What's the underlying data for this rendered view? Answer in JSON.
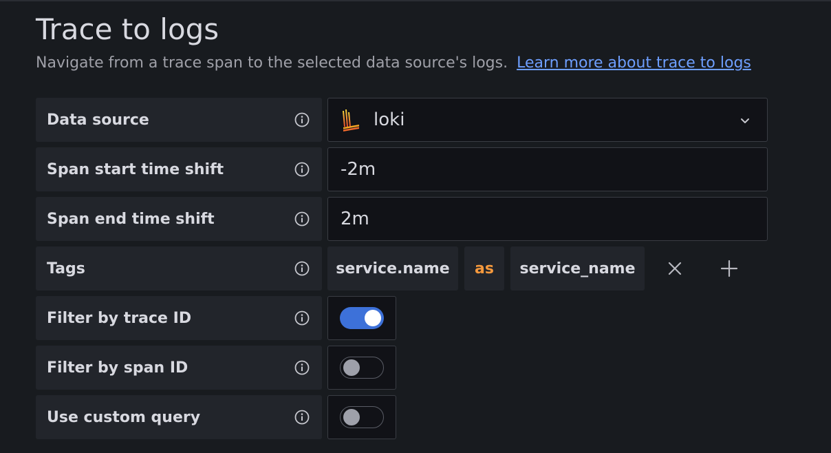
{
  "section": {
    "title": "Trace to logs",
    "description": "Navigate from a trace span to the selected data source's logs.",
    "learn_more_link": "Learn more about trace to logs"
  },
  "fields": {
    "data_source": {
      "label": "Data source",
      "value": "loki",
      "icon": "loki-logo-icon"
    },
    "span_start": {
      "label": "Span start time shift",
      "value": "-2m"
    },
    "span_end": {
      "label": "Span end time shift",
      "value": "2m"
    },
    "tags": {
      "label": "Tags",
      "key": "service.name",
      "as_label": "as",
      "value": "service_name"
    },
    "filter_trace_id": {
      "label": "Filter by trace ID",
      "enabled": true
    },
    "filter_span_id": {
      "label": "Filter by span ID",
      "enabled": false
    },
    "custom_query": {
      "label": "Use custom query",
      "enabled": false
    }
  },
  "colors": {
    "background": "#181b1f",
    "label_bg": "#22252b",
    "input_bg": "#111217",
    "link": "#6e9fff",
    "toggle_on": "#3d71d9",
    "tag_as": "#f5993d"
  }
}
